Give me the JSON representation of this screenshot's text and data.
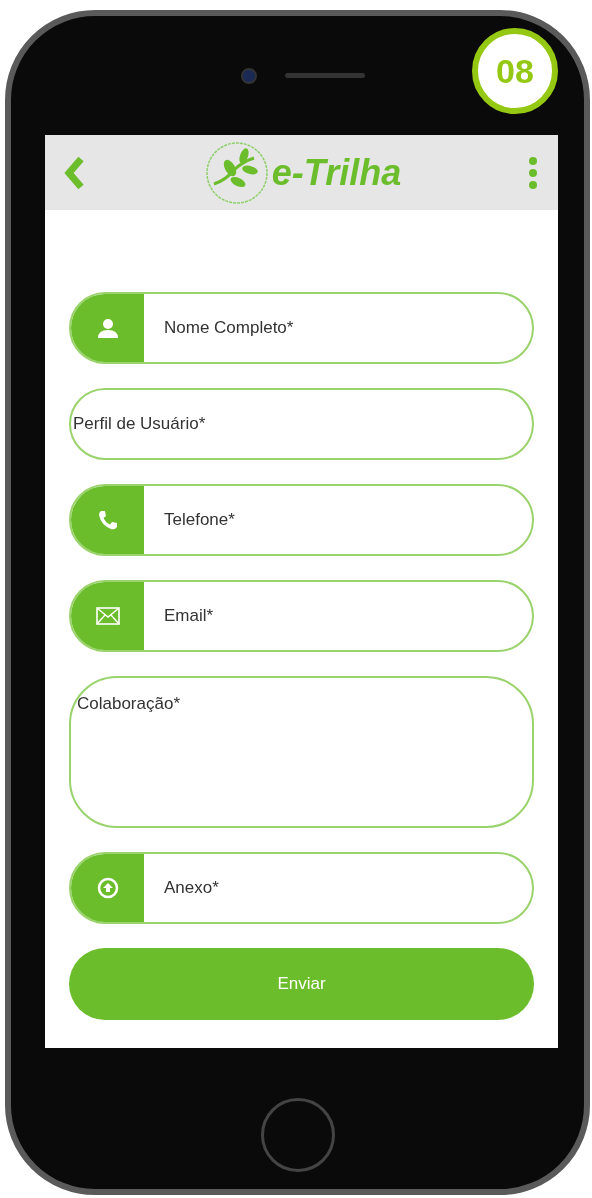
{
  "badge": "08",
  "header": {
    "title": "e-Trilha"
  },
  "fields": [
    {
      "kind": "icon",
      "placeholder": "Nome Completo*"
    },
    {
      "kind": "plain",
      "placeholder": "Perfil de Usuário*"
    },
    {
      "kind": "icon",
      "placeholder": "Telefone*"
    },
    {
      "kind": "icon",
      "placeholder": "Email*"
    },
    {
      "kind": "textarea",
      "placeholder": "Colaboração*"
    },
    {
      "kind": "icon",
      "placeholder": "Anexo*"
    }
  ],
  "submit": "Enviar"
}
